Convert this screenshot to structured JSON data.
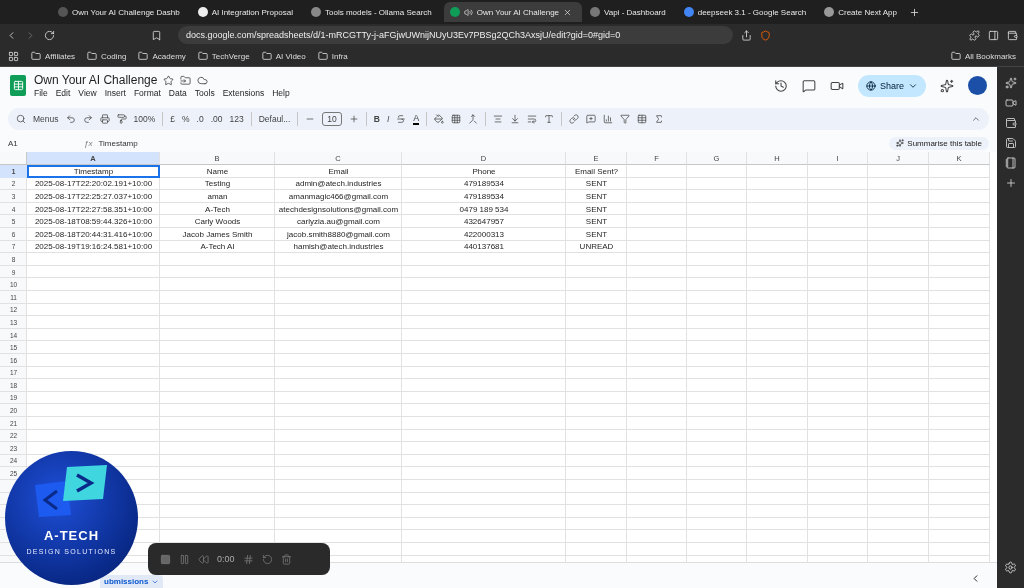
{
  "browser": {
    "tabs": [
      {
        "title": "Own Your AI Challenge Dashb",
        "selected": false
      },
      {
        "title": "AI Integration Proposal",
        "selected": false
      },
      {
        "title": "Tools models - Ollama Search",
        "selected": false
      },
      {
        "title": "Own Your AI Challenge",
        "selected": true
      },
      {
        "title": "Vapi - Dashboard",
        "selected": false
      },
      {
        "title": "deepseek 3.1 - Google Search",
        "selected": false
      },
      {
        "title": "Create Next App",
        "selected": false
      }
    ],
    "address": "docs.google.com/spreadsheets/d/1-mRCGTTy-j-aFGjwUWnijNUyU3Ev7PBSg2QCh3AxsjU/edit?gid=0#gid=0",
    "bookmarks": [
      "Affiliates",
      "Coding",
      "Academy",
      "TechVerge",
      "AI Video",
      "Infra"
    ],
    "all_bookmarks": "All Bookmarks"
  },
  "document": {
    "title": "Own Your AI Challenge",
    "menu": [
      "File",
      "Edit",
      "View",
      "Insert",
      "Format",
      "Data",
      "Tools",
      "Extensions",
      "Help"
    ],
    "share": "Share"
  },
  "toolbar": {
    "search": "Menus",
    "zoom": "100%",
    "currency": "£",
    "percent": "%",
    "decrease_decimal": ".0",
    "increase_decimal": ".00",
    "number_format": "123",
    "font": "Defaul...",
    "font_size": "10",
    "bold": "B",
    "italic": "I",
    "text_color": "A"
  },
  "formula_bar": {
    "cell": "A1",
    "fx": "ƒx",
    "content": "Timestamp",
    "summarise": "Summarise this table"
  },
  "sheet": {
    "columns": [
      {
        "label": "A",
        "selected": true
      },
      {
        "label": "B",
        "selected": false
      },
      {
        "label": "C",
        "selected": false
      },
      {
        "label": "D",
        "selected": false
      },
      {
        "label": "E",
        "selected": false
      },
      {
        "label": "F",
        "selected": false
      },
      {
        "label": "G",
        "selected": false
      },
      {
        "label": "H",
        "selected": false
      },
      {
        "label": "I",
        "selected": false
      },
      {
        "label": "J",
        "selected": false
      },
      {
        "label": "K",
        "selected": false
      }
    ],
    "rows": [
      {
        "number": "1",
        "selected": true,
        "cells": [
          "Timestamp",
          "Name",
          "Email",
          "Phone",
          "Email Sent?"
        ]
      },
      {
        "number": "2",
        "selected": false,
        "cells": [
          "2025-08-17T22:20:02.191+10:00",
          "Testing",
          "admin@atech.industries",
          "479189534",
          "SENT"
        ]
      },
      {
        "number": "3",
        "selected": false,
        "cells": [
          "2025-08-17T22:25:27.037+10:00",
          "aman",
          "amanmagic466@gmail.com",
          "479189534",
          "SENT"
        ]
      },
      {
        "number": "4",
        "selected": false,
        "cells": [
          "2025-08-17T22:27:58.351+10:00",
          "A-Tech",
          "atechdesignsolutions@gmail.com",
          "0479 189 534",
          "SENT"
        ]
      },
      {
        "number": "5",
        "selected": false,
        "cells": [
          "2025-08-18T08:59:44.326+10:00",
          "Carly Woods",
          "carlyzia.au@gmail.com",
          "432647957",
          "SENT"
        ]
      },
      {
        "number": "6",
        "selected": false,
        "cells": [
          "2025-08-18T20:44:31.416+10:00",
          "Jacob James Smith",
          "jacob.smith8880@gmail.com",
          "422000313",
          "SENT"
        ]
      },
      {
        "number": "7",
        "selected": false,
        "cells": [
          "2025-08-19T19:16:24.581+10:00",
          "A-Tech AI",
          "hamish@atech.industries",
          "440137681",
          "UNREAD"
        ]
      },
      {
        "number": "8",
        "selected": false
      },
      {
        "number": "9",
        "selected": false
      },
      {
        "number": "10",
        "selected": false
      },
      {
        "number": "11",
        "selected": false
      },
      {
        "number": "12",
        "selected": false
      },
      {
        "number": "13",
        "selected": false
      },
      {
        "number": "14",
        "selected": false
      },
      {
        "number": "15",
        "selected": false
      },
      {
        "number": "16",
        "selected": false
      },
      {
        "number": "17",
        "selected": false
      },
      {
        "number": "18",
        "selected": false
      },
      {
        "number": "19",
        "selected": false
      },
      {
        "number": "20",
        "selected": false
      },
      {
        "number": "21",
        "selected": false
      },
      {
        "number": "22",
        "selected": false
      },
      {
        "number": "23",
        "selected": false
      },
      {
        "number": "24",
        "selected": false
      },
      {
        "number": "25",
        "selected": false
      }
    ],
    "sheet_tab": "ubmissions"
  },
  "logo": {
    "name": "A-TECH",
    "tagline": "DESIGN SOLUTIONS"
  },
  "recorder": {
    "time": "0:00"
  }
}
